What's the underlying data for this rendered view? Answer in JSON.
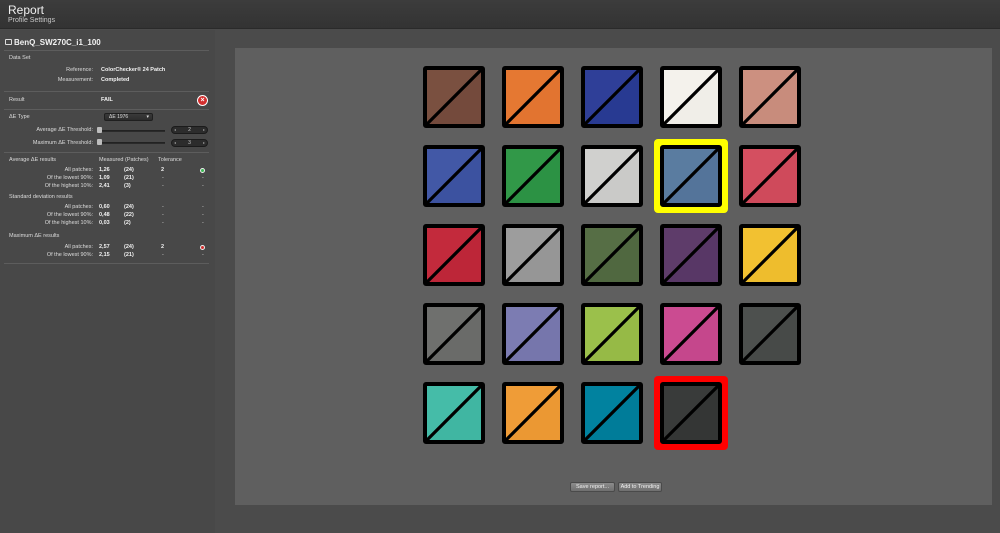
{
  "window": {
    "title": "Report",
    "subtitle": "Profile Settings"
  },
  "device": {
    "name": "BenQ_SW270C_i1_100"
  },
  "dataset": {
    "header": "Data Set",
    "reference_label": "Reference:",
    "reference_value": "ColorChecker® 24 Patch",
    "measurement_label": "Measurement:",
    "measurement_value": "Completed"
  },
  "result": {
    "label": "Result",
    "value": "FAIL",
    "icon": "fail-icon",
    "icon_glyph": "×"
  },
  "delta_e": {
    "type_label": "ΔE Type",
    "type_value": "ΔE 1976",
    "avg_threshold_label": "Average ΔE Threshold:",
    "avg_threshold_value": "2",
    "max_threshold_label": "Maximum ΔE Threshold:",
    "max_threshold_value": "3"
  },
  "results": {
    "avg_header": "Average ΔE results",
    "measured_header": "Measured (Patches)",
    "tolerance_header": "Tolerance",
    "avg_rows": [
      {
        "label": "All patches:",
        "measured": "1,26",
        "patches": "(24)",
        "tolerance": "2",
        "status": "pass"
      },
      {
        "label": "Of the lowest 90%:",
        "measured": "1,09",
        "patches": "(21)",
        "tolerance": "-",
        "status": "-"
      },
      {
        "label": "Of the highest 10%:",
        "measured": "2,41",
        "patches": "(3)",
        "tolerance": "-",
        "status": "-"
      }
    ],
    "std_header": "Standard deviation results",
    "std_rows": [
      {
        "label": "All patches:",
        "measured": "0,60",
        "patches": "(24)",
        "tolerance": "-",
        "status": "-"
      },
      {
        "label": "Of the lowest 90%:",
        "measured": "0,48",
        "patches": "(22)",
        "tolerance": "-",
        "status": "-"
      },
      {
        "label": "Of the highest 10%:",
        "measured": "0,03",
        "patches": "(2)",
        "tolerance": "-",
        "status": "-"
      }
    ],
    "max_header": "Maximum ΔE results",
    "max_rows": [
      {
        "label": "All patches:",
        "measured": "2,57",
        "patches": "(24)",
        "tolerance": "2",
        "status": "fail"
      },
      {
        "label": "Of the lowest 90%:",
        "measured": "2,15",
        "patches": "(21)",
        "tolerance": "-",
        "status": "-"
      }
    ]
  },
  "colors": {
    "pass": "#3cba54",
    "fail": "#d32f2f",
    "highlight_yellow": "#ffff00",
    "highlight_red": "#ff0000"
  },
  "patches": [
    {
      "reference": "#7a5040",
      "measured": "#744a3c"
    },
    {
      "reference": "#e57832",
      "measured": "#e27430"
    },
    {
      "reference": "#2f3f98",
      "measured": "#283a92"
    },
    {
      "reference": "#f4f2ec",
      "measured": "#f0eee8"
    },
    {
      "reference": "#cc9080",
      "measured": "#c88c7c"
    },
    {
      "reference": "#4258a6",
      "measured": "#3c52a0"
    },
    {
      "reference": "#319848",
      "measured": "#2c9244"
    },
    {
      "reference": "#d0d0ce",
      "measured": "#cacac8"
    },
    {
      "reference": "#5a7ca0",
      "measured": "#54749a",
      "highlight": "yellow"
    },
    {
      "reference": "#d44f60",
      "measured": "#cf4a5b"
    },
    {
      "reference": "#c32a3c",
      "measured": "#bd2638"
    },
    {
      "reference": "#9d9d9d",
      "measured": "#969696"
    },
    {
      "reference": "#566e45",
      "measured": "#506840"
    },
    {
      "reference": "#5e3c6a",
      "measured": "#583766"
    },
    {
      "reference": "#f2c131",
      "measured": "#eebd2d"
    },
    {
      "reference": "#6f706e",
      "measured": "#6a6b69"
    },
    {
      "reference": "#7c7cb2",
      "measured": "#7676ac"
    },
    {
      "reference": "#9bc04b",
      "measured": "#96ba46"
    },
    {
      "reference": "#cb4b91",
      "measured": "#c5478c"
    },
    {
      "reference": "#4d504e",
      "measured": "#474a48"
    },
    {
      "reference": "#45bca8",
      "measured": "#40b6a2"
    },
    {
      "reference": "#ef9c37",
      "measured": "#eb9833"
    },
    {
      "reference": "#01829f",
      "measured": "#007c99"
    },
    {
      "reference": "#393b3a",
      "measured": "#343635",
      "highlight": "red"
    }
  ],
  "actions": {
    "save_report": "Save report...",
    "add_trending": "Add to Trending"
  }
}
